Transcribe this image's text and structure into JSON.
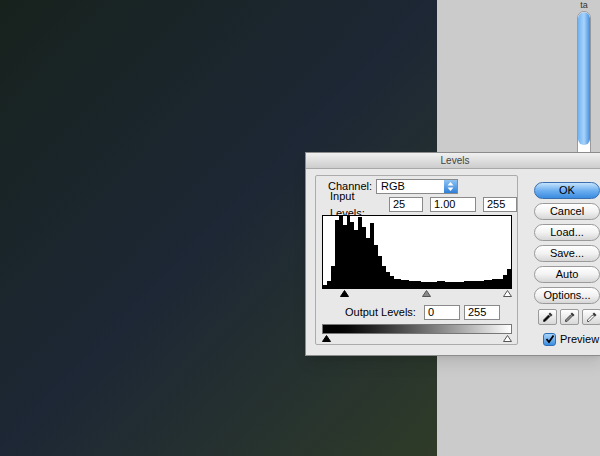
{
  "side_panel": {
    "text": "ta",
    "scrollbar": {
      "level": 0.9
    }
  },
  "dialog": {
    "title": "Levels",
    "channel": {
      "label": "Channel:",
      "value": "RGB"
    },
    "input_levels": {
      "label": "Input Levels:",
      "values": [
        "25",
        "1.00",
        "255"
      ]
    },
    "histogram": {
      "values": [
        4,
        10,
        30,
        95,
        100,
        88,
        100,
        92,
        80,
        98,
        85,
        70,
        90,
        60,
        45,
        30,
        22,
        16,
        13,
        12,
        11,
        11,
        10,
        10,
        10,
        9,
        9,
        9,
        9,
        10,
        10,
        9,
        9,
        9,
        9,
        9,
        10,
        10,
        10,
        10,
        10,
        11,
        11,
        12,
        12,
        13,
        18,
        26
      ]
    },
    "input_sliders": [
      {
        "kind": "black",
        "level": 0.1
      },
      {
        "kind": "gray",
        "level": 0.55
      },
      {
        "kind": "white",
        "level": 1
      }
    ],
    "output_levels": {
      "label": "Output Levels:",
      "values": [
        "0",
        "255"
      ]
    },
    "output_sliders": [
      {
        "kind": "black",
        "level": 0
      },
      {
        "kind": "white",
        "level": 1
      }
    ],
    "buttons": [
      {
        "label": "OK",
        "default": true
      },
      {
        "label": "Cancel",
        "default": false
      },
      {
        "label": "Load...",
        "default": false
      },
      {
        "label": "Save...",
        "default": false
      },
      {
        "label": "Auto",
        "default": false
      },
      {
        "label": "Options...",
        "default": false
      }
    ],
    "eyedroppers": [
      {
        "kind": "black"
      },
      {
        "kind": "gray"
      },
      {
        "kind": "white"
      }
    ],
    "preview": {
      "label": "Preview",
      "checked": true
    }
  }
}
